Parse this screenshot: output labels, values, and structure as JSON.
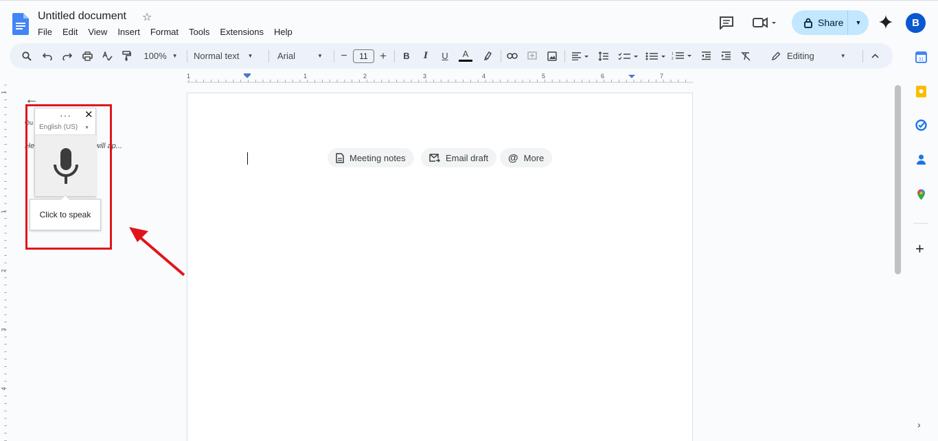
{
  "app": {
    "title": "Untitled document",
    "menu": [
      "File",
      "Edit",
      "View",
      "Insert",
      "Format",
      "Tools",
      "Extensions",
      "Help"
    ],
    "share_label": "Share",
    "avatar_initial": "B",
    "brand_color": "#4285f4"
  },
  "toolbar": {
    "zoom": "100%",
    "style": "Normal text",
    "font": "Arial",
    "font_size": "11",
    "mode": "Editing"
  },
  "ruler": {
    "numbers": [
      "1",
      "1",
      "2",
      "3",
      "4",
      "5",
      "6",
      "7"
    ],
    "vertical_numbers": [
      "1",
      "1",
      "2",
      "3",
      "4"
    ]
  },
  "outline": {
    "label": "Ou",
    "hint": "He...o the document will ap..."
  },
  "voice_typing": {
    "language": "English (US)",
    "tooltip": "Click to speak",
    "annotation_color": "#e0151b"
  },
  "document": {
    "chips": [
      "Meeting notes",
      "Email draft",
      "More"
    ]
  }
}
